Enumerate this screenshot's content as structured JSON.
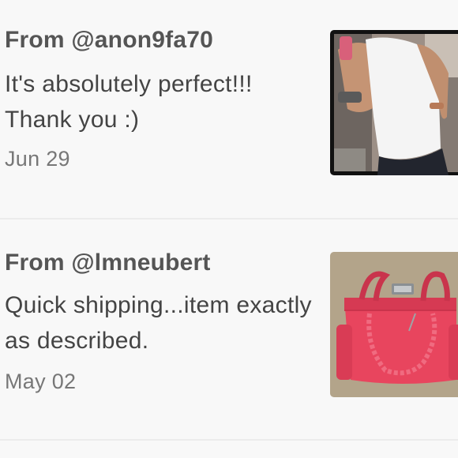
{
  "reviews": [
    {
      "from_label": "From @anon9fa70",
      "comment": "It's absolutely perfect!!! Thank you :)",
      "date": "Jun 29",
      "thumbnail_icon": "photo-thumbnail-white-top"
    },
    {
      "from_label": "From @lmneubert",
      "comment": "Quick shipping...item exactly as described.",
      "date": "May 02",
      "thumbnail_icon": "photo-thumbnail-pink-handbag"
    }
  ],
  "colors": {
    "background": "#f8f8f8",
    "divider": "#ececec",
    "username_text": "#555555",
    "comment_text": "#444444",
    "date_text": "#777777",
    "handbag_pink": "#e8455e"
  }
}
